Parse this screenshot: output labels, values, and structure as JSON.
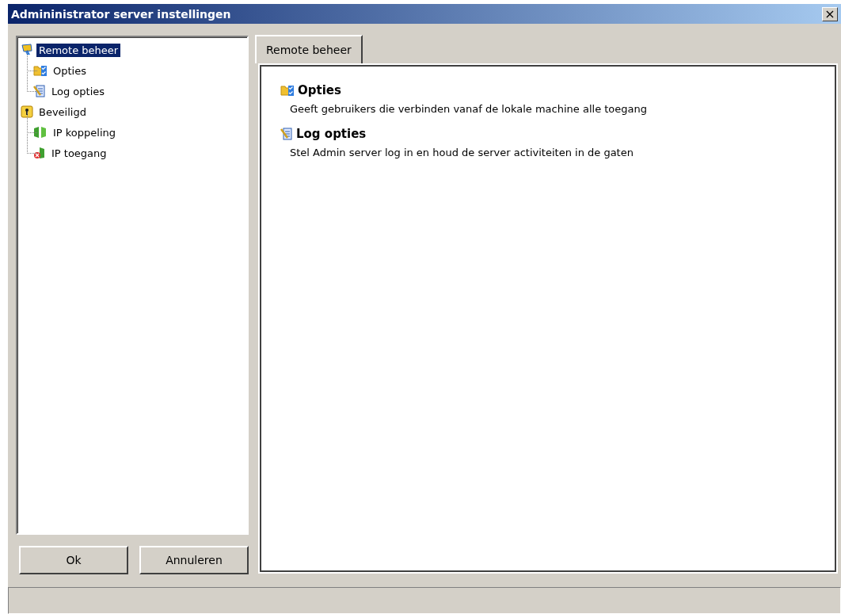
{
  "window": {
    "title": "Admininistrator server instellingen",
    "close_glyph": "×"
  },
  "tree": [
    {
      "label": "Remote beheer",
      "kind": "monitor",
      "selected": true,
      "children": [
        {
          "label": "Opties",
          "kind": "options",
          "selected": false
        },
        {
          "label": "Log opties",
          "kind": "log",
          "selected": false
        }
      ]
    },
    {
      "label": "Beveiligd",
      "kind": "lock",
      "selected": false,
      "children": [
        {
          "label": "IP koppeling",
          "kind": "link",
          "selected": false
        },
        {
          "label": "IP toegang",
          "kind": "deny",
          "selected": false
        }
      ]
    }
  ],
  "buttons": [
    "Ok",
    "Annuleren"
  ],
  "tabs": [
    {
      "label": "Remote beheer",
      "selected": true
    }
  ],
  "sections": [
    {
      "kind": "options",
      "title": "Opties",
      "description": "Geeft gebruikers die verbinden vanaf de lokale machine alle toegang"
    },
    {
      "kind": "log",
      "title": "Log opties",
      "description": "Stel Admin server log in en houd de server activiteiten in de gaten"
    }
  ]
}
